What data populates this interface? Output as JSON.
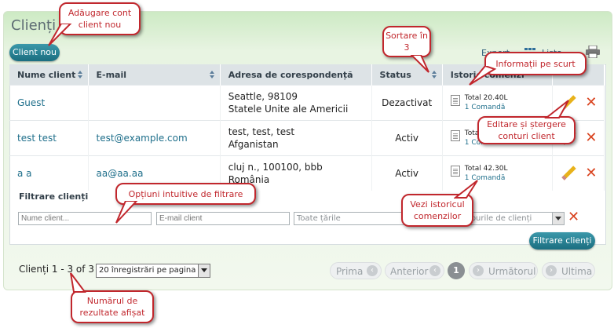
{
  "page": {
    "title": "Clienți"
  },
  "toolbar": {
    "new_client_label": "Client nou",
    "export_label": "Export",
    "list_label": "Lista"
  },
  "table": {
    "headers": {
      "name": "Nume client",
      "email": "E-mail",
      "address": "Adresa de corespondență",
      "status": "Status",
      "history": "Istoric comenzi"
    },
    "rows": [
      {
        "name": "Guest",
        "email": "",
        "address_line1": "Seattle, 98109",
        "address_line2": "Statele Unite ale Americii",
        "status": "Dezactivat",
        "history_total": "Total 20.40L",
        "history_orders": "1 Comandă"
      },
      {
        "name": "test test",
        "email": "test@example.com",
        "address_line1": "test, test, test",
        "address_line2": "Afganistan",
        "status": "Activ",
        "history_total": "Total 20.40L",
        "history_orders": "1 Comandă"
      },
      {
        "name": "a a",
        "email": "aa@aa.aa",
        "address_line1": "cluj n., 100100, bbb",
        "address_line2": "România",
        "status": "Activ",
        "history_total": "Total 42.30L",
        "history_orders": "1 Comandă"
      }
    ]
  },
  "filter": {
    "label": "Filtrare clienți",
    "name_placeholder": "Nume client...",
    "email_placeholder": "E-mail client",
    "country_value": "Toate țările",
    "group_value": "Toate grupurile de clienți",
    "button_label": "Filtrare clienți"
  },
  "footer": {
    "count_text": "Clienți 1 - 3 of 3",
    "per_page_value": "20 înregistrări pe pagina",
    "pagination": {
      "first": "Prima",
      "prev": "Anterior",
      "current": "1",
      "next": "Următorul",
      "last": "Ultima"
    }
  },
  "callouts": {
    "add_account": "Adăugare cont client nou",
    "sorting": "Sortare în 3",
    "quick_info": "Informații pe scurt",
    "edit_delete": "Editare și ștergere conturi client",
    "filter_options": "Opțiuni intuitive de filtrare",
    "order_history": "Vezi istoricul comenzilor",
    "results_count": "Numărul de rezultate afișat"
  },
  "colors": {
    "accent": "#1b6e80",
    "callout": "#c1272d",
    "status_inactive": "#c6521b",
    "status_active": "#3e7d1d"
  }
}
